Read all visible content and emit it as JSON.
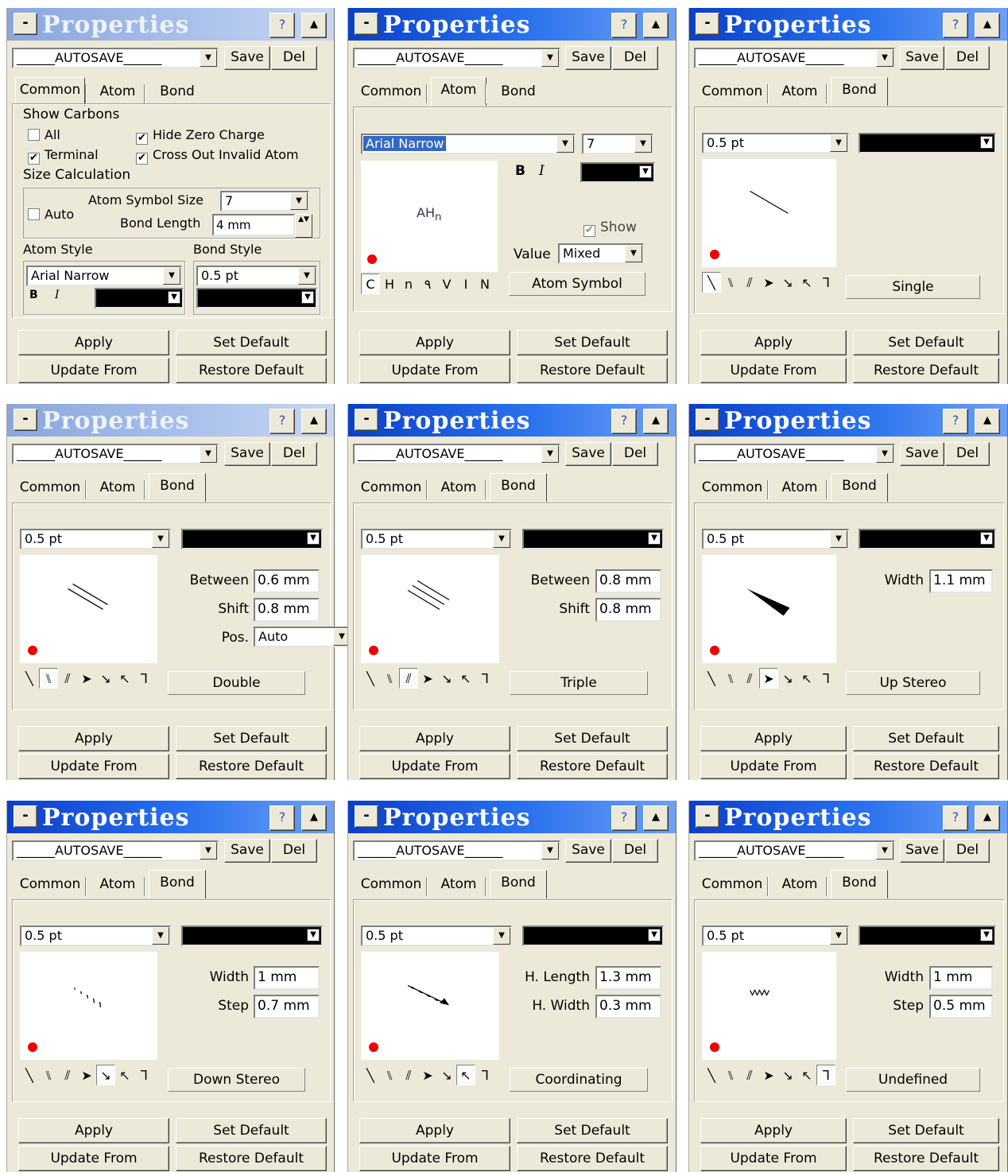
{
  "common": {
    "title": "Properties",
    "help": "?",
    "collapse": "▲",
    "minimize": "-",
    "preset": "______AUTOSAVE______",
    "save": "Save",
    "del": "Del",
    "tabs": {
      "common": "Common",
      "atom": "Atom",
      "bond": "Bond"
    },
    "apply": "Apply",
    "set_default": "Set Default",
    "update_from": "Update From",
    "restore_default": "Restore Default",
    "bond_width": "0.5 pt",
    "bond_glyphs": [
      "╲",
      "⑊",
      "⫽",
      "➤",
      "↘",
      "↖",
      "ᒣ"
    ],
    "icons": {
      "dropdown": "chevron-down-icon",
      "color": "black"
    }
  },
  "panels": {
    "p1": {
      "show_carbons": "Show Carbons",
      "all": "All",
      "terminal": "Terminal",
      "hide_zero_charge": "Hide Zero Charge",
      "cross_out": "Cross Out Invalid Atom",
      "size_calc": "Size Calculation",
      "auto": "Auto",
      "atom_symbol_size_label": "Atom Symbol Size",
      "atom_symbol_size": "7",
      "bond_length_label": "Bond Length",
      "bond_length": "4 mm",
      "atom_style": "Atom Style",
      "bond_style": "Bond Style",
      "font": "Arial Narrow",
      "bold": "B",
      "italic": "I",
      "bond_width": "0.5 pt"
    },
    "p2": {
      "font": "Arial Narrow",
      "size": "7",
      "bold": "B",
      "italic": "I",
      "preview": "AH",
      "preview_sub": "n",
      "show": "Show",
      "value_label": "Value",
      "value": "Mixed",
      "atom_symbol": "Atom Symbol",
      "modes": [
        "C",
        "H",
        "n",
        "٩",
        "V",
        "I",
        "N"
      ]
    },
    "p3": {
      "type": "Single"
    },
    "p4": {
      "between_label": "Between",
      "between": "0.6 mm",
      "shift_label": "Shift",
      "shift": "0.8 mm",
      "pos_label": "Pos.",
      "pos": "Auto",
      "type": "Double"
    },
    "p5": {
      "between_label": "Between",
      "between": "0.8 mm",
      "shift_label": "Shift",
      "shift": "0.8 mm",
      "type": "Triple"
    },
    "p6": {
      "width_label": "Width",
      "width": "1.1 mm",
      "type": "Up Stereo"
    },
    "p7": {
      "width_label": "Width",
      "width": "1 mm",
      "step_label": "Step",
      "step": "0.7 mm",
      "type": "Down Stereo"
    },
    "p8": {
      "hlength_label": "H. Length",
      "hlength": "1.3 mm",
      "hwidth_label": "H. Width",
      "hwidth": "0.3 mm",
      "type": "Coordinating"
    },
    "p9": {
      "width_label": "Width",
      "width": "1 mm",
      "step_label": "Step",
      "step": "0.5 mm",
      "type": "Undefined"
    }
  }
}
